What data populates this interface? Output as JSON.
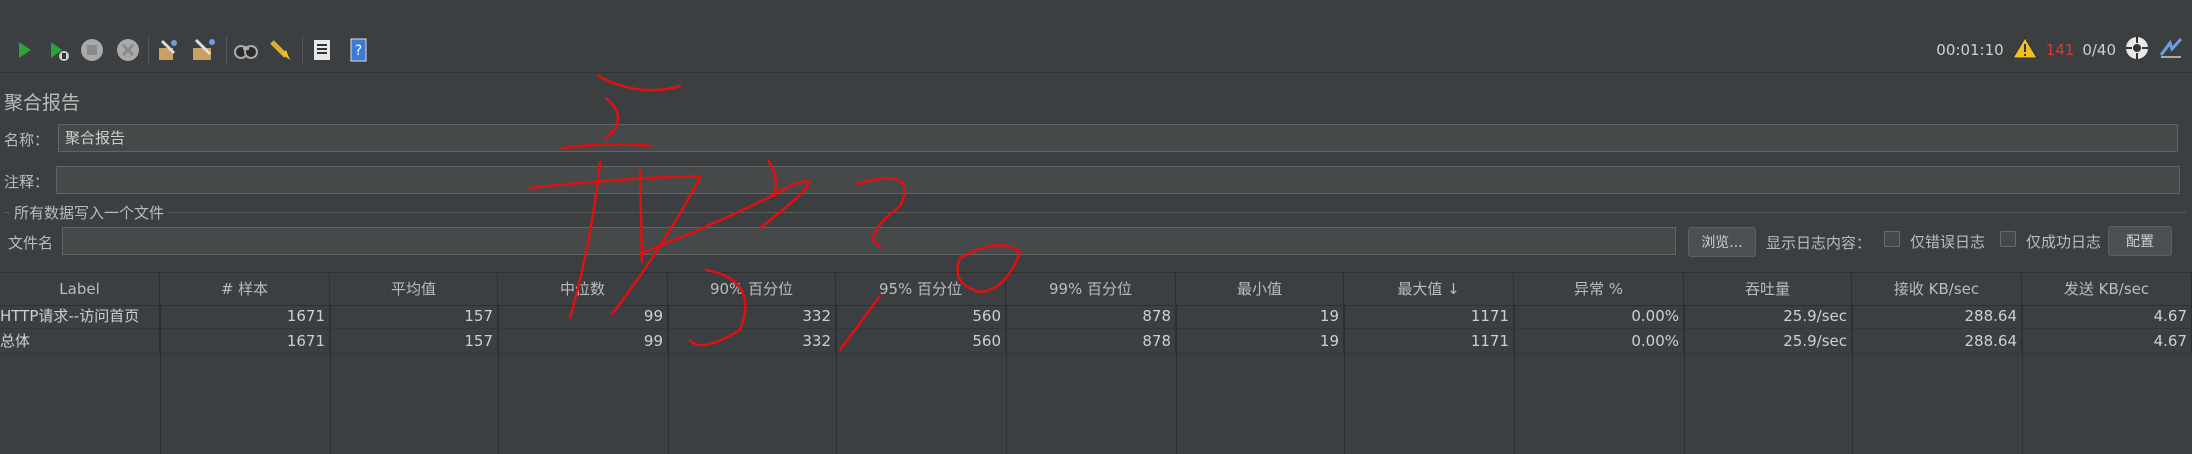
{
  "toolbar": {
    "icons": [
      "start-icon",
      "start-no-pause-icon",
      "stop-icon",
      "shutdown-icon",
      "clear-icon",
      "clear-all-icon",
      "search-icon",
      "reset-search-icon",
      "function-helper-icon",
      "help-icon"
    ]
  },
  "status": {
    "elapsed": "00:01:10",
    "warnings": "141",
    "threads": "0/40"
  },
  "report": {
    "title": "聚合报告",
    "name_label": "名称：",
    "name_value": "聚合报告",
    "comment_label": "注释：",
    "comment_value": "",
    "file_group_title": "所有数据写入一个文件",
    "file_label": "文件名",
    "file_value": "",
    "browse_button": "浏览...",
    "log_label": "显示日志内容：",
    "errors_only": "仅错误日志",
    "success_only": "仅成功日志",
    "config_button": "配置"
  },
  "table": {
    "headers": [
      "Label",
      "# 样本",
      "平均值",
      "中位数",
      "90% 百分位",
      "95% 百分位",
      "99% 百分位",
      "最小值",
      "最大值 ↓",
      "异常 %",
      "吞吐量",
      "接收 KB/sec",
      "发送 KB/sec"
    ],
    "rows": [
      [
        "HTTP请求--访问首页",
        "1671",
        "157",
        "99",
        "332",
        "560",
        "878",
        "19",
        "1171",
        "0.00%",
        "25.9/sec",
        "288.64",
        "4.67"
      ],
      [
        "总体",
        "1671",
        "157",
        "99",
        "332",
        "560",
        "878",
        "19",
        "1171",
        "0.00%",
        "25.9/sec",
        "288.64",
        "4.67"
      ]
    ]
  },
  "colors": {
    "background": "#3c3f41",
    "field": "#45494a",
    "warning_count": "#e0392a",
    "annotation": "#e01010"
  }
}
